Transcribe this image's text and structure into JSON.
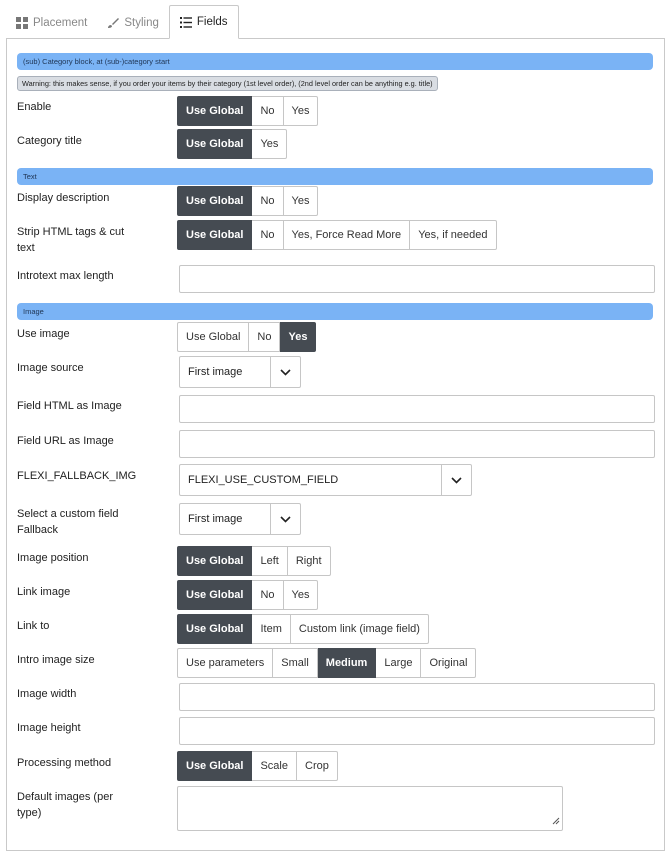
{
  "tabs": [
    {
      "label": "Placement",
      "icon": "grid-icon"
    },
    {
      "label": "Styling",
      "icon": "brush-icon"
    },
    {
      "label": "Fields",
      "icon": "list-icon",
      "active": true
    }
  ],
  "colors": {
    "section_bar": "#7ab3f5",
    "active_button": "#454b52"
  },
  "sections": {
    "category_block": "(sub) Category block, at (sub-)category start",
    "warning": "Warning: this makes sense, if you order your items by their category (1st level order), (2nd level order can be anything e.g. title)",
    "text": "Text",
    "image": "Image"
  },
  "fields": {
    "enable": {
      "label": "Enable",
      "options": [
        "Use Global",
        "No",
        "Yes"
      ],
      "selected": "Use Global"
    },
    "category_title": {
      "label": "Category title",
      "options": [
        "Use Global",
        "Yes"
      ],
      "selected": "Use Global"
    },
    "display_description": {
      "label": "Display description",
      "options": [
        "Use Global",
        "No",
        "Yes"
      ],
      "selected": "Use Global"
    },
    "strip_html": {
      "label": "Strip HTML tags & cut text",
      "options": [
        "Use Global",
        "No",
        "Yes, Force Read More",
        "Yes, if needed"
      ],
      "selected": "Use Global"
    },
    "introtext_max_length": {
      "label": "Introtext max length",
      "value": ""
    },
    "use_image": {
      "label": "Use image",
      "options": [
        "Use Global",
        "No",
        "Yes"
      ],
      "selected": "Yes"
    },
    "image_source": {
      "label": "Image source",
      "value": "First image"
    },
    "field_html_as_image": {
      "label": "Field HTML as Image",
      "value": ""
    },
    "field_url_as_image": {
      "label": "Field URL as Image",
      "value": ""
    },
    "flexi_fallback_img": {
      "label": "FLEXI_FALLBACK_IMG",
      "value": "FLEXI_USE_CUSTOM_FIELD"
    },
    "custom_field_fallback": {
      "label": "Select a custom field Fallback",
      "value": "First image"
    },
    "image_position": {
      "label": "Image position",
      "options": [
        "Use Global",
        "Left",
        "Right"
      ],
      "selected": "Use Global"
    },
    "link_image": {
      "label": "Link image",
      "options": [
        "Use Global",
        "No",
        "Yes"
      ],
      "selected": "Use Global"
    },
    "link_to": {
      "label": "Link to",
      "options": [
        "Use Global",
        "Item",
        "Custom link (image field)"
      ],
      "selected": "Use Global"
    },
    "intro_image_size": {
      "label": "Intro image size",
      "options": [
        "Use parameters",
        "Small",
        "Medium",
        "Large",
        "Original"
      ],
      "selected": "Medium"
    },
    "image_width": {
      "label": "Image width",
      "value": ""
    },
    "image_height": {
      "label": "Image height",
      "value": ""
    },
    "processing_method": {
      "label": "Processing method",
      "options": [
        "Use Global",
        "Scale",
        "Crop"
      ],
      "selected": "Use Global"
    },
    "default_images": {
      "label": "Default images (per type)",
      "value": ""
    }
  }
}
